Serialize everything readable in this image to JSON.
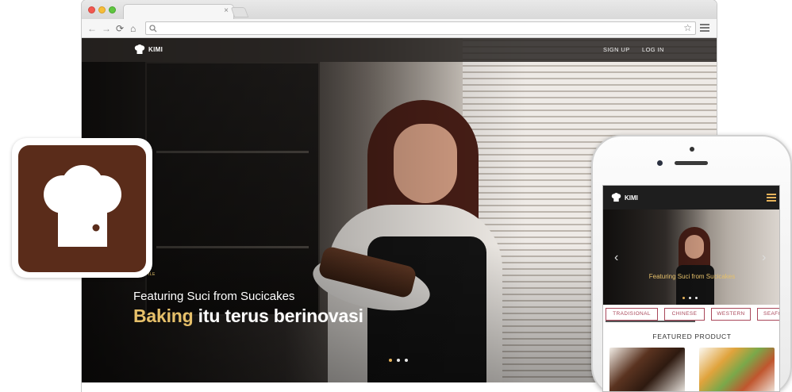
{
  "browser": {
    "tab_close": "×",
    "nav_back": "←",
    "nav_forward": "→",
    "nav_reload": "⟳",
    "nav_home": "⌂",
    "address_value": "",
    "star": "☆"
  },
  "site": {
    "brand": "KIMI",
    "nav": [
      "SIGN UP",
      "LOG IN"
    ]
  },
  "hero": {
    "kicker": "PROFILE",
    "subtitle": "Featuring Suci from Sucicakes",
    "title_highlight": "Baking",
    "title_rest": " itu terus berinovasi",
    "slides": 3,
    "active_slide": 1
  },
  "mobile": {
    "brand": "KIMI",
    "hero_caption": "Featuring Suci from Sucicakes",
    "prev": "‹",
    "next": "›",
    "categories": [
      "TRADISIONAL",
      "CHINESE",
      "WESTERN",
      "SEAFO"
    ],
    "featured_heading": "FEATURED PRODUCT"
  },
  "colors": {
    "brand_brown": "#5a2c1a",
    "accent_gold": "#e6c06a",
    "category_border": "#a9475a"
  }
}
